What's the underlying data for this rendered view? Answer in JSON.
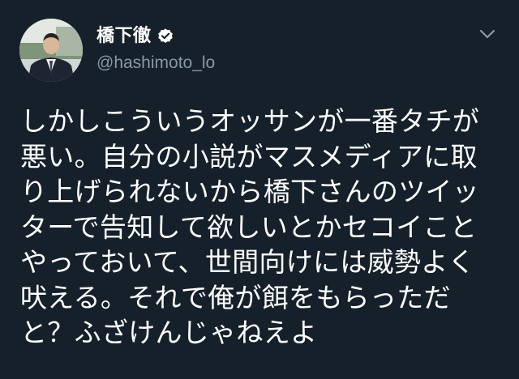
{
  "tweet": {
    "author": {
      "display_name": "橋下徹",
      "handle": "@hashimoto_lo",
      "verified": true
    },
    "text": "しかしこういうオッサンが一番タチが\n悪い。自分の小説がマスメディアに取\nり上げられないから橋下さんのツイッ\nターで告知して欲しいとかセコイこと\nやっておいて、世間向けには威勢よく\n吠える。それで俺が餌をもらっただ\nと？ふざけんじゃねえよ"
  },
  "icons": {
    "avatar": "profile-photo",
    "verified": "verified-badge-icon",
    "menu": "chevron-down-icon"
  },
  "colors": {
    "background": "#15202b",
    "text_primary": "#ffffff",
    "text_secondary": "#8899a6",
    "chevron": "#8899a6"
  }
}
